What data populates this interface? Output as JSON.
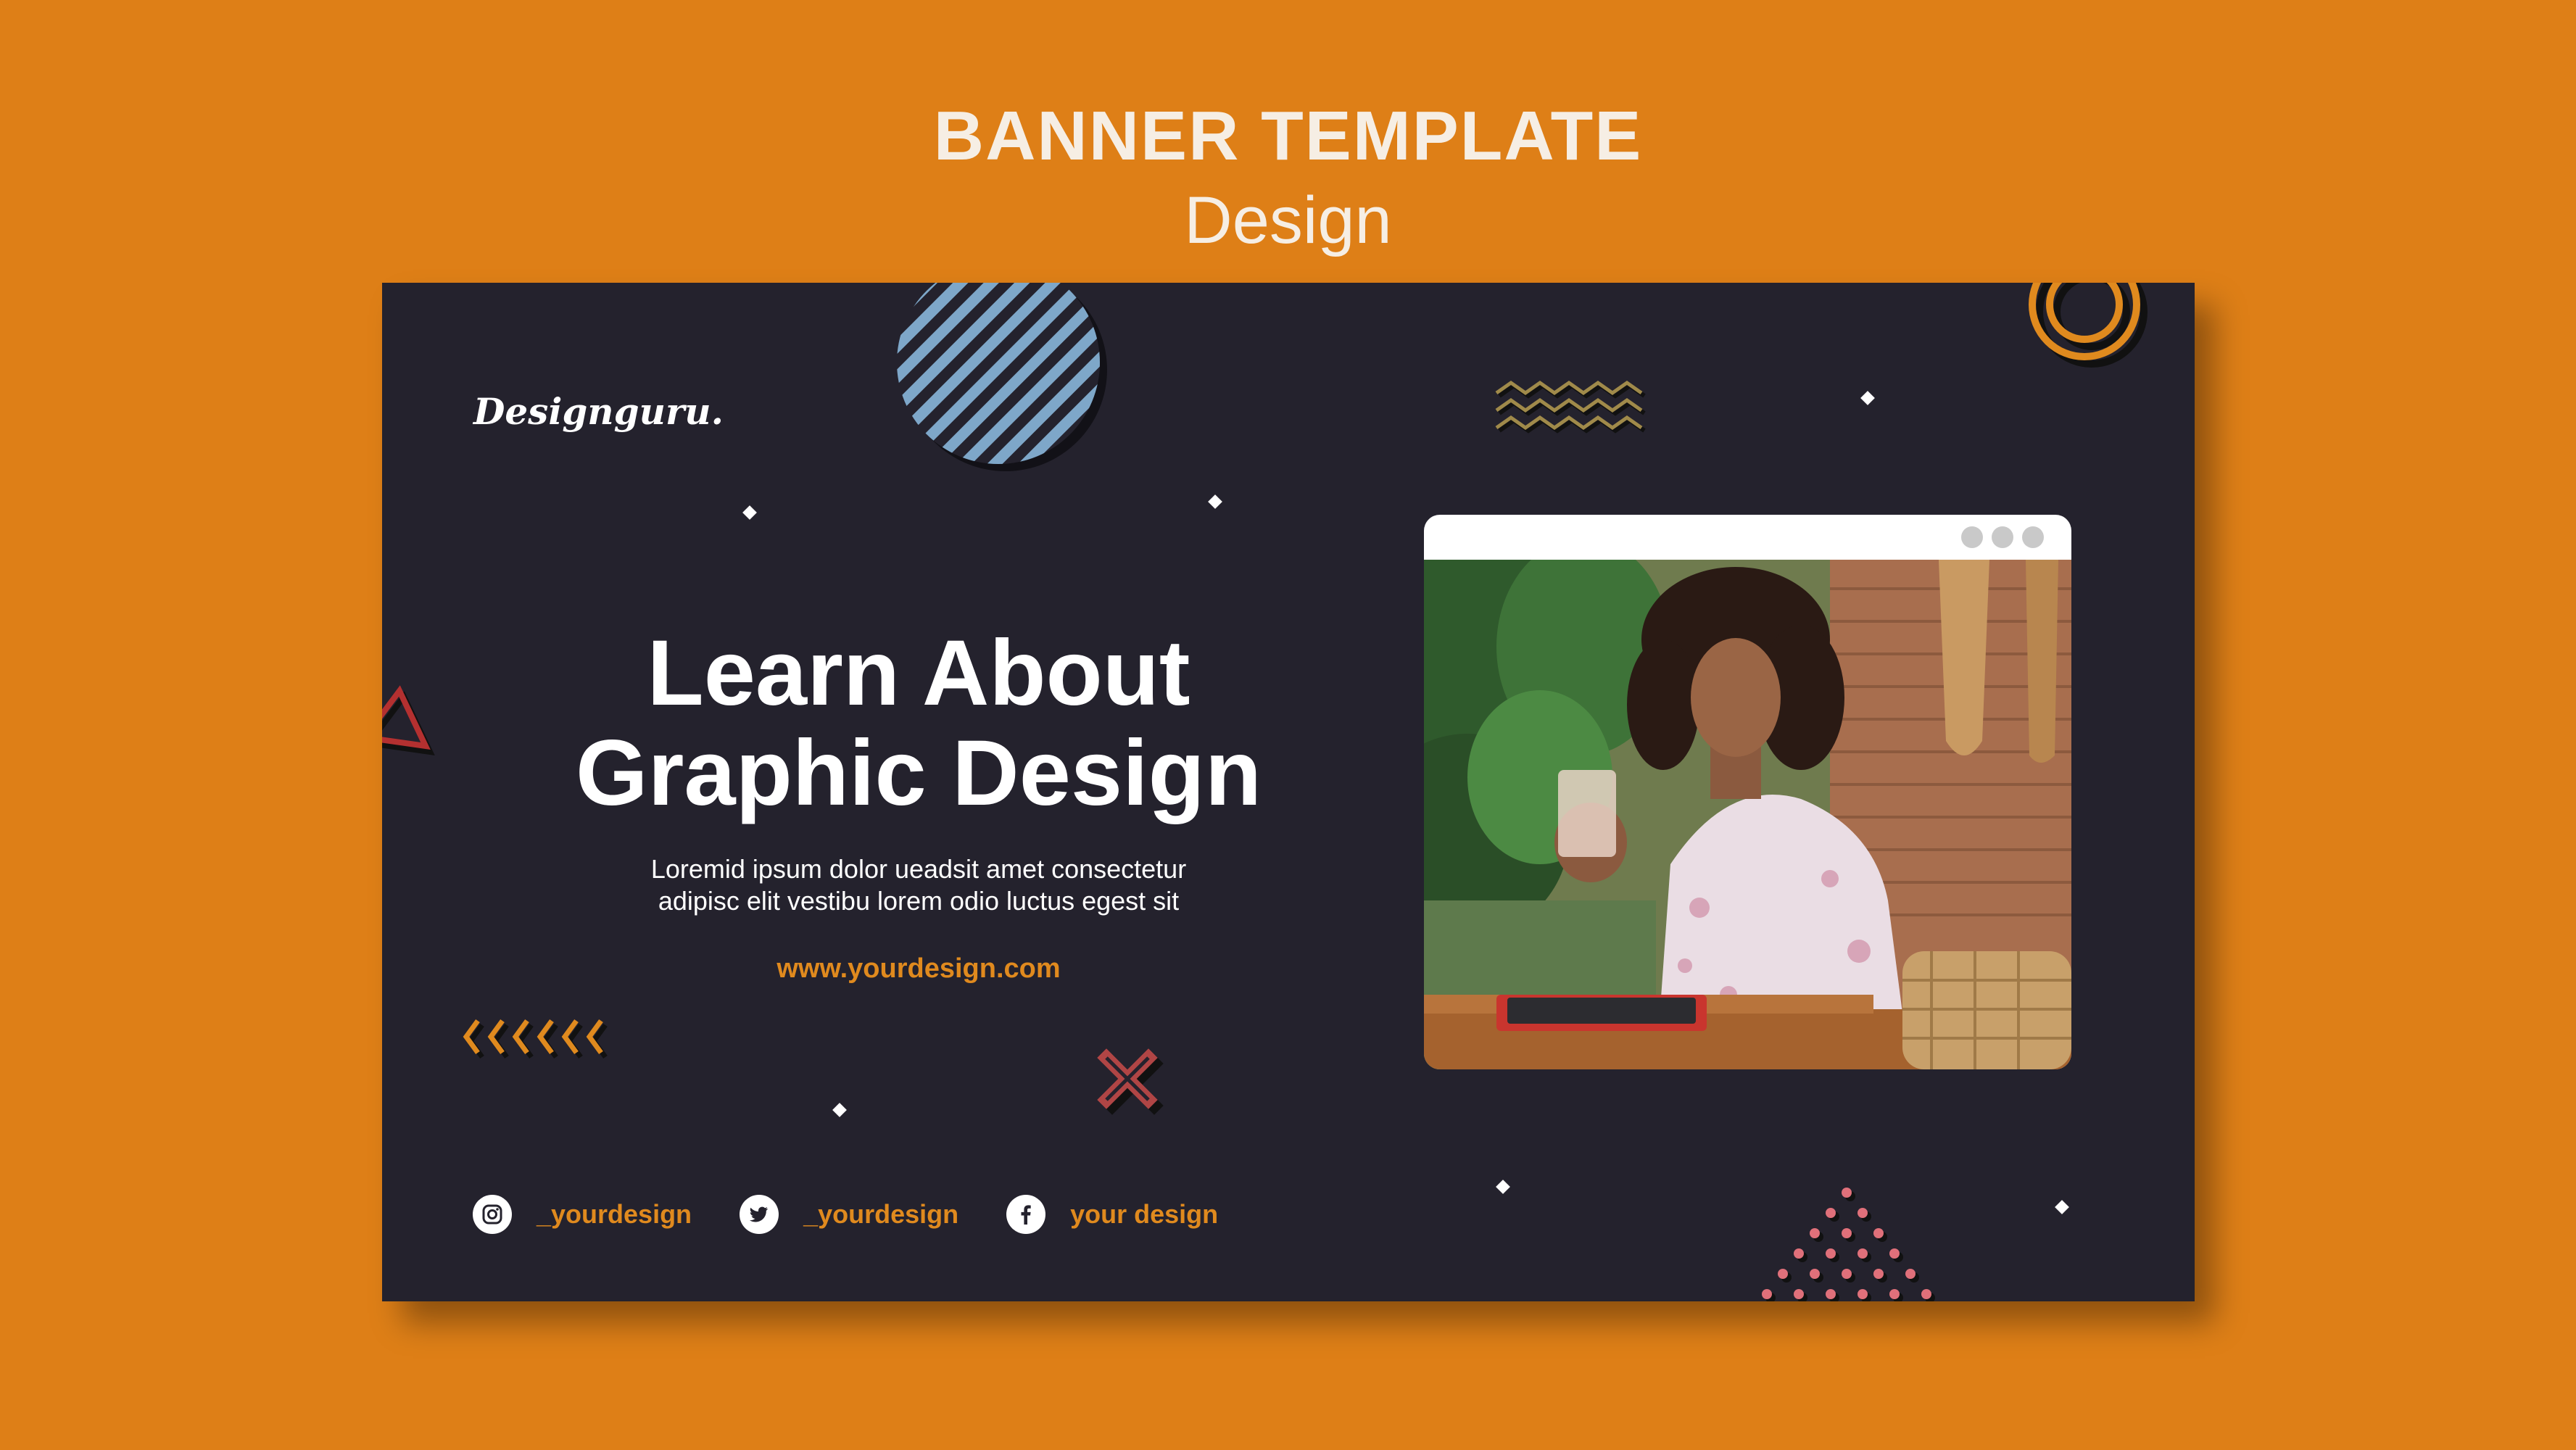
{
  "header": {
    "title": "BANNER TEMPLATE",
    "subtitle": "Design"
  },
  "banner": {
    "logo": "Designguru.",
    "headline_line1": "Learn About",
    "headline_line2": "Graphic Design",
    "body_line1": "Loremid ipsum dolor ueadsit amet consectetur",
    "body_line2": "adipisc elit vestibu lorem odio luctus egest sit",
    "url": "www.yourdesign.com",
    "socials": [
      {
        "icon": "instagram-icon",
        "handle": "_yourdesign"
      },
      {
        "icon": "twitter-icon",
        "handle": "_yourdesign"
      },
      {
        "icon": "facebook-icon",
        "handle": "your design"
      }
    ]
  },
  "colors": {
    "background": "#DE7F17",
    "banner": "#24222D",
    "accent": "#E08A1E",
    "stripe_blue": "#7EA7C9",
    "dot_pink": "#E0707A"
  }
}
